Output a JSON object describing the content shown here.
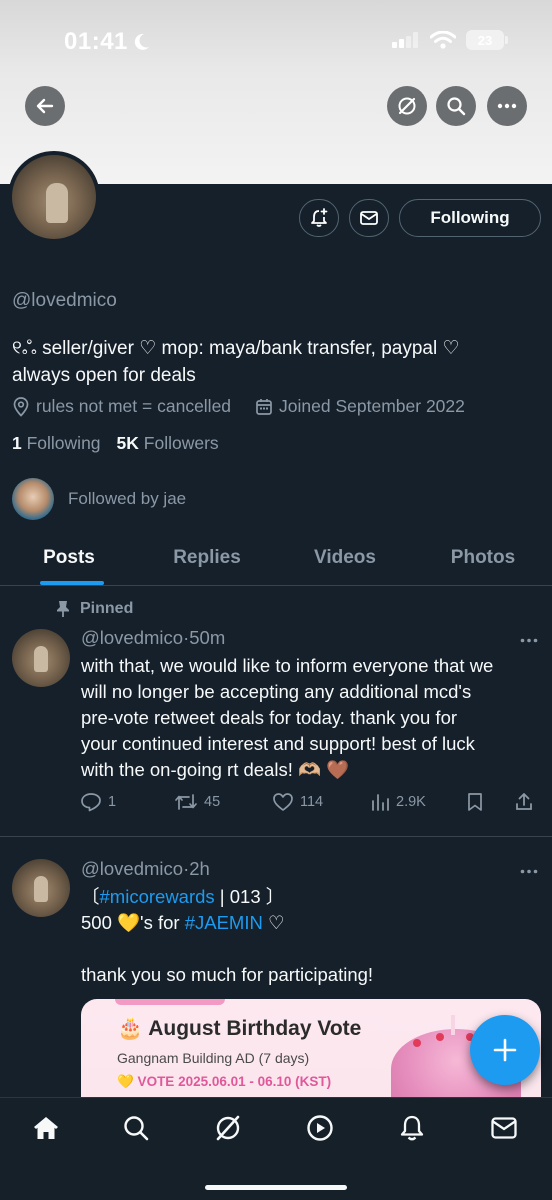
{
  "status_bar": {
    "time": "01:41",
    "battery": "23"
  },
  "profile": {
    "handle": "@lovedmico",
    "bio_line1": "୧ஃ seller/giver ♡ mop: maya/bank transfer, paypal ♡",
    "bio_line2": "always open for deals",
    "location": "rules not met = cancelled",
    "joined": "Joined September 2022",
    "following_count": "1",
    "following_label": "Following",
    "followers_count": "5K",
    "followers_label": "Followers",
    "followed_by": "Followed by jae",
    "follow_button": "Following"
  },
  "tabs": [
    {
      "label": "Posts",
      "active": true
    },
    {
      "label": "Replies",
      "active": false
    },
    {
      "label": "Videos",
      "active": false
    },
    {
      "label": "Photos",
      "active": false
    }
  ],
  "tweets": [
    {
      "pinned_label": "Pinned",
      "author": "@lovedmico",
      "sep": "·",
      "time": "50m",
      "lines": [
        "with that, we would like to inform everyone that we",
        "will no longer be accepting any additional mcd's",
        "pre-vote retweet deals for today. thank you for",
        "your continued interest and support! best of luck",
        "with the on-going rt deals! 🫶🏼 🤎"
      ],
      "replies": "1",
      "retweets": "45",
      "likes": "114",
      "views": "2.9K"
    },
    {
      "author": "@lovedmico",
      "sep": "·",
      "time": "2h",
      "line1_open": "〔",
      "line1_tag": "#micorewards",
      "line1_rest": " | 013 〕",
      "line2_pre": "500 💛's for ",
      "line2_tag": "#JAEMIN",
      "line2_post": " ♡",
      "line3": "thank you so much for participating!",
      "card": {
        "title": "🎂 August Birthday Vote",
        "subtitle": "Gangnam Building AD (7 days)",
        "vote": "💛 VOTE  2025.06.01 - 06.10 (KST)"
      }
    }
  ],
  "colors": {
    "accent": "#1d9bf0",
    "background": "#15202b",
    "muted": "#8b98a5"
  }
}
